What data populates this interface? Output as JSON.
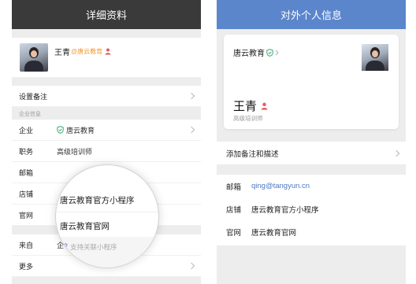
{
  "left": {
    "title": "详细资料",
    "profile": {
      "name": "王青",
      "company_tag": "@唐云教育"
    },
    "remark_label": "设置备注",
    "section_title": "企业信息",
    "rows": [
      {
        "label": "企业",
        "value": "唐云教育"
      },
      {
        "label": "职务",
        "value": "高级培训师"
      },
      {
        "label": "邮箱",
        "value": ""
      },
      {
        "label": "店铺",
        "value": ""
      },
      {
        "label": "官网",
        "value": ""
      }
    ],
    "bottom_rows": [
      {
        "label": "来自",
        "value": "企"
      },
      {
        "label": "更多",
        "value": ""
      }
    ],
    "magnifier": {
      "item1": "唐云教育官方小程序",
      "item2": "唐云教育官网",
      "footer": "支持关联小程序"
    }
  },
  "right": {
    "title": "对外个人信息",
    "card": {
      "company": "唐云教育",
      "name": "王青",
      "job_title": "高级培训师"
    },
    "add_remark": "添加备注和描述",
    "info": [
      {
        "label": "邮箱",
        "value": "qing@tangyun.cn"
      },
      {
        "label": "店铺",
        "value": "唐云教育官方小程序"
      },
      {
        "label": "官网",
        "value": "唐云教育官网"
      }
    ]
  },
  "colors": {
    "left_header": "#3a3a3a",
    "right_header": "#5b86cc",
    "accent_orange": "#f29a38",
    "verified_green": "#3aa876",
    "person_red": "#e85a5a",
    "link_blue": "#4a78c2"
  },
  "icons": {
    "verified": "shield-check-icon",
    "person": "person-icon",
    "chevron": "chevron-right-icon",
    "link": "link-icon"
  }
}
